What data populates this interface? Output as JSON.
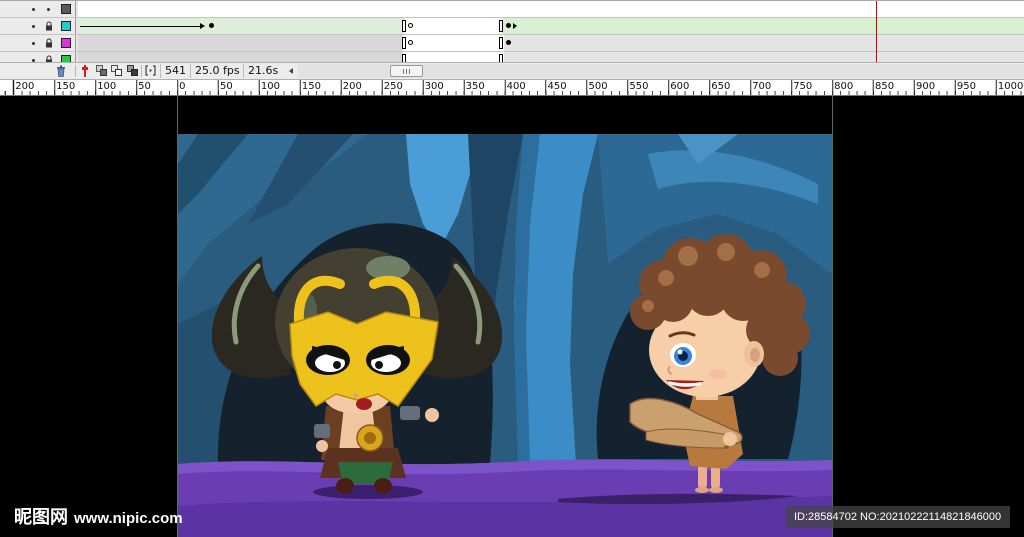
{
  "timeline": {
    "layers": [
      {
        "eye_icon": "dot-icon",
        "lock_icon": "dot-icon",
        "outline_color": "#5a5a5a"
      },
      {
        "eye_icon": "dot-icon",
        "lock_icon": "lock-icon",
        "outline_color": "#22cccc"
      },
      {
        "eye_icon": "dot-icon",
        "lock_icon": "lock-icon",
        "outline_color": "#dd33dd"
      },
      {
        "eye_icon": "dot-icon",
        "lock_icon": "lock-icon",
        "outline_color": "#22cc44"
      }
    ],
    "playhead_color": "#cc0000",
    "tween_color": "#dcefd6"
  },
  "controls": {
    "icons": [
      "trash-icon",
      "center-frame-icon",
      "onion-skin-icon",
      "onion-skin-outlines-icon",
      "edit-multiple-frames-icon",
      "modify-markers-icon",
      "scroll-left-arrow-icon",
      "grip-icon"
    ],
    "current_frame": "541",
    "frame_rate": "25.0 fps",
    "elapsed_time": "21.6s"
  },
  "ruler": {
    "labels": [
      "200",
      "150",
      "100",
      "50",
      "0",
      "50",
      "100",
      "150",
      "200",
      "250",
      "300",
      "350",
      "400",
      "450",
      "500",
      "550",
      "600",
      "650",
      "700",
      "750",
      "800",
      "850",
      "900",
      "950",
      "1000"
    ]
  },
  "stage": {
    "background": "#000000",
    "border_color": "#56705a"
  },
  "watermark": {
    "site_name": "昵图网",
    "url": "www.nipic.com",
    "image_id": "ID:28584702 NO:20210222114821846000"
  }
}
